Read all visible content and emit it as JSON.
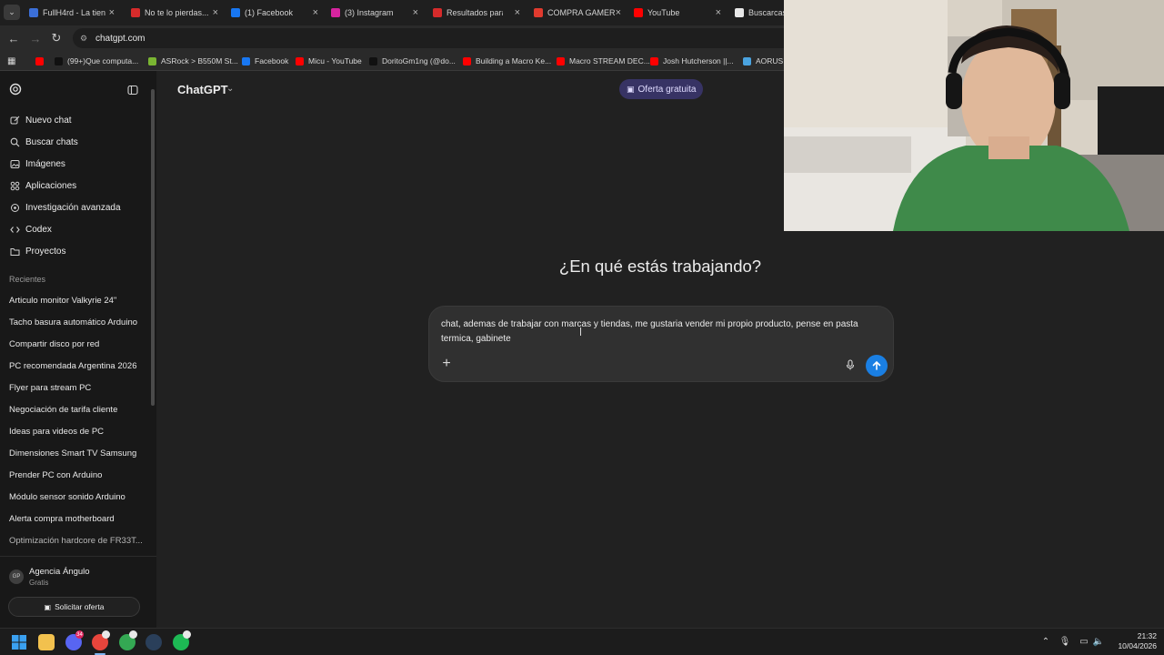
{
  "browser": {
    "tabs": [
      {
        "label": "FullH4rd - La tien",
        "color": "#3b6fd8"
      },
      {
        "label": "No te lo pierdas...",
        "color": "#d62b2b"
      },
      {
        "label": "(1) Facebook",
        "color": "#1877f2"
      },
      {
        "label": "(3) Instagram",
        "color": "#d6249f"
      },
      {
        "label": "Resultados para i",
        "color": "#d62b2b"
      },
      {
        "label": "COMPRA GAMER",
        "color": "#e03a2e"
      },
      {
        "label": "YouTube",
        "color": "#ff0000"
      },
      {
        "label": "Buscarcase",
        "color": "#e8e8e8"
      }
    ],
    "url": "chatgpt.com",
    "bookmarks": [
      {
        "label": "(99+)Que computa...",
        "color": "#111111"
      },
      {
        "label": "ASRock > B550M St...",
        "color": "#7ab532"
      },
      {
        "label": "Facebook",
        "color": "#1877f2"
      },
      {
        "label": "Micu - YouTube",
        "color": "#ff0000"
      },
      {
        "label": "DoritoGm1ng (@do...",
        "color": "#111111"
      },
      {
        "label": "Building a Macro Ke...",
        "color": "#ff0000"
      },
      {
        "label": "Macro STREAM DEC...",
        "color": "#ff0000"
      },
      {
        "label": "Josh Hutcherson ||...",
        "color": "#ff0000"
      },
      {
        "label": "AORUS F",
        "color": "#4aa3df"
      }
    ]
  },
  "sidebar": {
    "nav": [
      {
        "label": "Nuevo chat",
        "icon": "edit-icon"
      },
      {
        "label": "Buscar chats",
        "icon": "search-icon"
      },
      {
        "label": "Imágenes",
        "icon": "image-icon"
      },
      {
        "label": "Aplicaciones",
        "icon": "apps-icon"
      },
      {
        "label": "Investigación avanzada",
        "icon": "research-icon"
      },
      {
        "label": "Codex",
        "icon": "codex-icon"
      },
      {
        "label": "Proyectos",
        "icon": "folder-icon"
      }
    ],
    "recent_header": "Recientes",
    "recents": [
      "Articulo monitor Valkyrie 24\"",
      "Tacho basura automático Arduino",
      "Compartir disco por red",
      "PC recomendada Argentina 2026",
      "Flyer para stream PC",
      "Negociación de tarifa cliente",
      "Ideas para videos de PC",
      "Dimensiones Smart TV Samsung",
      "Prender PC con Arduino",
      "Módulo sensor sonido Arduino",
      "Alerta compra motherboard",
      "Optimización hardcore de FR33T..."
    ],
    "profile": {
      "initials": "GP",
      "name": "Agencia Ángulo",
      "plan": "Gratis"
    },
    "offer_button": "Solicitar oferta"
  },
  "main": {
    "model": "ChatGPT",
    "promo": "Oferta gratuita",
    "headline": "¿En qué estás trabajando?",
    "composer_text": "chat, ademas de trabajar con marcas y tiendas, me gustaria vender mi propio producto, pense en pasta termica, gabinete"
  },
  "taskbar": {
    "apps": [
      {
        "name": "windows-start-icon",
        "color": "#2b8fe8"
      },
      {
        "name": "file-explorer-icon",
        "color": "#f2c14e"
      },
      {
        "name": "discord-icon",
        "color": "#5865f2",
        "badge": "34"
      },
      {
        "name": "chrome-icon",
        "color": "#e8453c",
        "badge": ""
      },
      {
        "name": "chrome-profile-icon",
        "color": "#34a853",
        "badge": ""
      },
      {
        "name": "steam-icon",
        "color": "#2a3f5a"
      },
      {
        "name": "spotify-icon",
        "color": "#1db954",
        "badge": ""
      }
    ],
    "time": "21:32",
    "date": "10/04/2026"
  }
}
